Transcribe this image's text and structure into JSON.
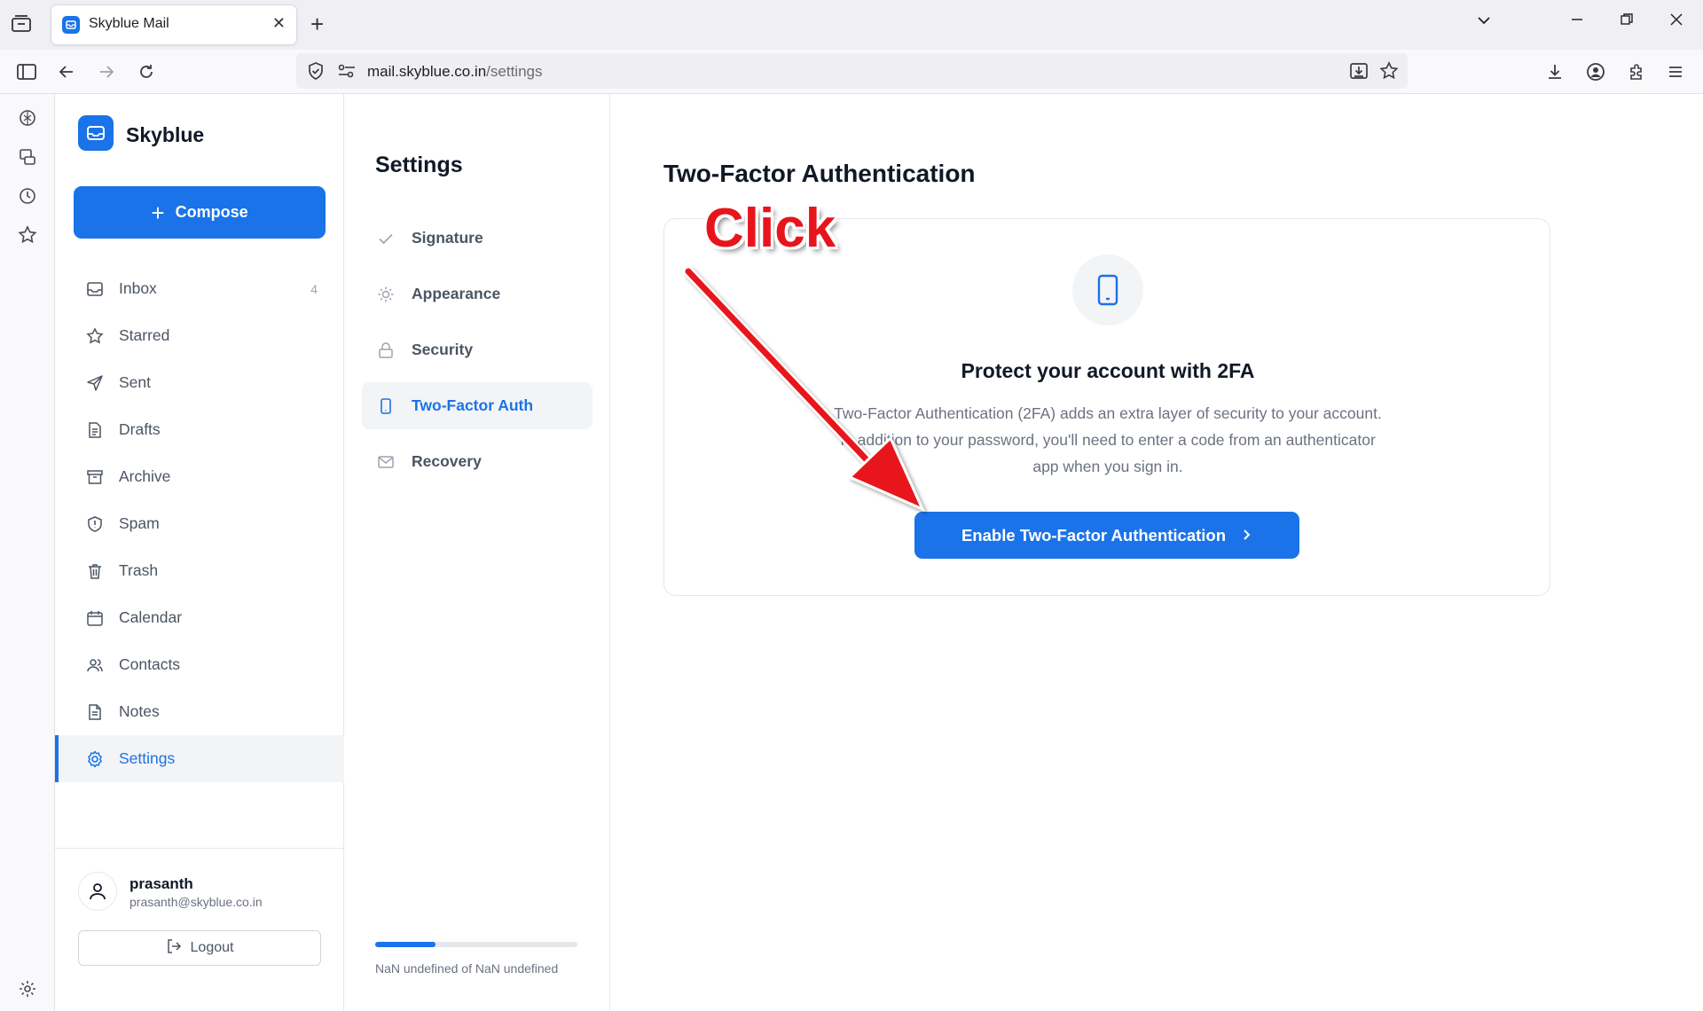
{
  "browser": {
    "tab_title": "Skyblue Mail",
    "url_host": "mail.skyblue.co.in",
    "url_path": "/settings"
  },
  "app": {
    "brand": "Skyblue",
    "compose_label": "Compose",
    "folders": [
      {
        "label": "Inbox",
        "count": "4",
        "icon": "inbox-icon"
      },
      {
        "label": "Starred",
        "icon": "star-icon"
      },
      {
        "label": "Sent",
        "icon": "send-icon"
      },
      {
        "label": "Drafts",
        "icon": "draft-icon"
      },
      {
        "label": "Archive",
        "icon": "archive-icon"
      },
      {
        "label": "Spam",
        "icon": "shield-icon"
      },
      {
        "label": "Trash",
        "icon": "trash-icon"
      },
      {
        "label": "Calendar",
        "icon": "calendar-icon"
      },
      {
        "label": "Contacts",
        "icon": "contacts-icon"
      },
      {
        "label": "Notes",
        "icon": "notes-icon"
      },
      {
        "label": "Settings",
        "icon": "gear-icon",
        "active": true
      }
    ],
    "user": {
      "name": "prasanth",
      "email": "prasanth@skyblue.co.in",
      "logout_label": "Logout"
    }
  },
  "settings": {
    "title": "Settings",
    "items": [
      {
        "label": "Signature",
        "icon": "check-icon"
      },
      {
        "label": "Appearance",
        "icon": "sun-icon"
      },
      {
        "label": "Security",
        "icon": "lock-icon"
      },
      {
        "label": "Two-Factor Auth",
        "icon": "phone-icon",
        "active": true
      },
      {
        "label": "Recovery",
        "icon": "mail-icon"
      }
    ],
    "progress_text": "NaN undefined of NaN undefined",
    "progress_fraction": 0.3
  },
  "main": {
    "title": "Two-Factor Authentication",
    "card_heading": "Protect your account with 2FA",
    "card_description": "Two-Factor Authentication (2FA) adds an extra layer of security to your account. In addition to your password, you'll need to enter a code from an authenticator app when you sign in.",
    "enable_button": "Enable Two-Factor Authentication"
  },
  "annotation": {
    "text": "Click",
    "color": "#e8141c"
  },
  "colors": {
    "accent": "#1a73e8"
  }
}
